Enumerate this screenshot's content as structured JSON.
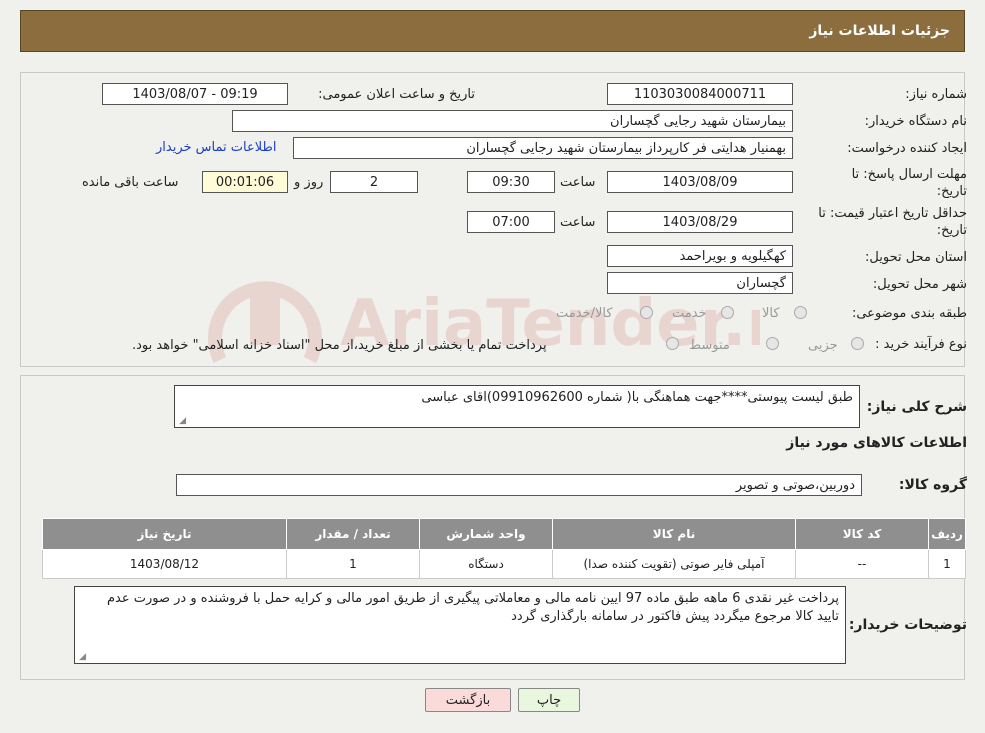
{
  "header": {
    "title": "جزئیات اطلاعات نیاز"
  },
  "form": {
    "need_no_label": "شماره نیاز:",
    "need_no": "1103030084000711",
    "announce_label": "تاریخ و ساعت اعلان عمومی:",
    "announce_value": "1403/08/07 - 09:19",
    "buyer_label": "نام دستگاه خریدار:",
    "buyer_value": "بیمارستان شهید رجایی گچساران",
    "creator_label": "ایجاد کننده درخواست:",
    "creator_value": "بهمنیار هدایتی فر کارپرداز بیمارستان شهید رجایی گچساران",
    "contact_link": "اطلاعات تماس خریدار",
    "deadline_label": "مهلت ارسال پاسخ: تا تاریخ:",
    "deadline_date": "1403/08/09",
    "time_label": "ساعت",
    "deadline_time": "09:30",
    "days_value": "2",
    "days_label": "روز و",
    "remaining_value": "00:01:06",
    "remaining_label": "ساعت باقی مانده",
    "validity_label": "حداقل تاریخ اعتبار قیمت: تا تاریخ:",
    "validity_date": "1403/08/29",
    "validity_time": "07:00",
    "province_label": "استان محل تحویل:",
    "province_value": "کهگیلویه و بویراحمد",
    "city_label": "شهر محل تحویل:",
    "city_value": "گچساران",
    "category_label": "طبقه بندی موضوعی:",
    "category_options": [
      "کالا",
      "خدمت",
      "کالا/خدمت"
    ],
    "process_label": "نوع فرآیند خرید :",
    "process_options": [
      "جزیی",
      "متوسط"
    ],
    "process_note": "پرداخت تمام یا بخشی از مبلغ خرید،از محل \"اسناد خزانه اسلامی\" خواهد بود."
  },
  "summary": {
    "label": "شرح کلی نیاز:",
    "value": "طبق لیست پیوستی****جهت هماهنگی با( شماره 09910962600)اقای عباسی"
  },
  "goods": {
    "section_title": "اطلاعات کالاهای مورد نیاز",
    "group_label": "گروه کالا:",
    "group_value": "دوربین،صوتی و تصویر",
    "columns": [
      "ردیف",
      "کد کالا",
      "نام کالا",
      "واحد شمارش",
      "تعداد / مقدار",
      "تاریخ نیاز"
    ],
    "rows": [
      {
        "row": "1",
        "code": "--",
        "name": "آمپلی فایر صوتی (تقویت کننده صدا)",
        "unit": "دستگاه",
        "qty": "1",
        "date": "1403/08/12"
      }
    ]
  },
  "notes": {
    "label": "توضیحات خریدار:",
    "value": "پرداخت غیر نقدی 6 ماهه  طبق ماده 97 ایین نامه مالی و معاملاتی پیگیری از طریق امور مالی  و کرایه حمل با فروشنده و در صورت عدم تایید کالا مرجوع میگردد پیش فاکتور در سامانه بارگذاری گردد"
  },
  "buttons": {
    "print": "چاپ",
    "back": "بازگشت"
  },
  "watermark": {
    "text": "AriaTender.neT"
  },
  "colors": {
    "header_bg": "#8b6d3e",
    "link": "#1a3fc7",
    "back_btn_bg": "#fbdada",
    "print_btn_bg": "#e8f7dd",
    "watermark": "#c0392b"
  }
}
